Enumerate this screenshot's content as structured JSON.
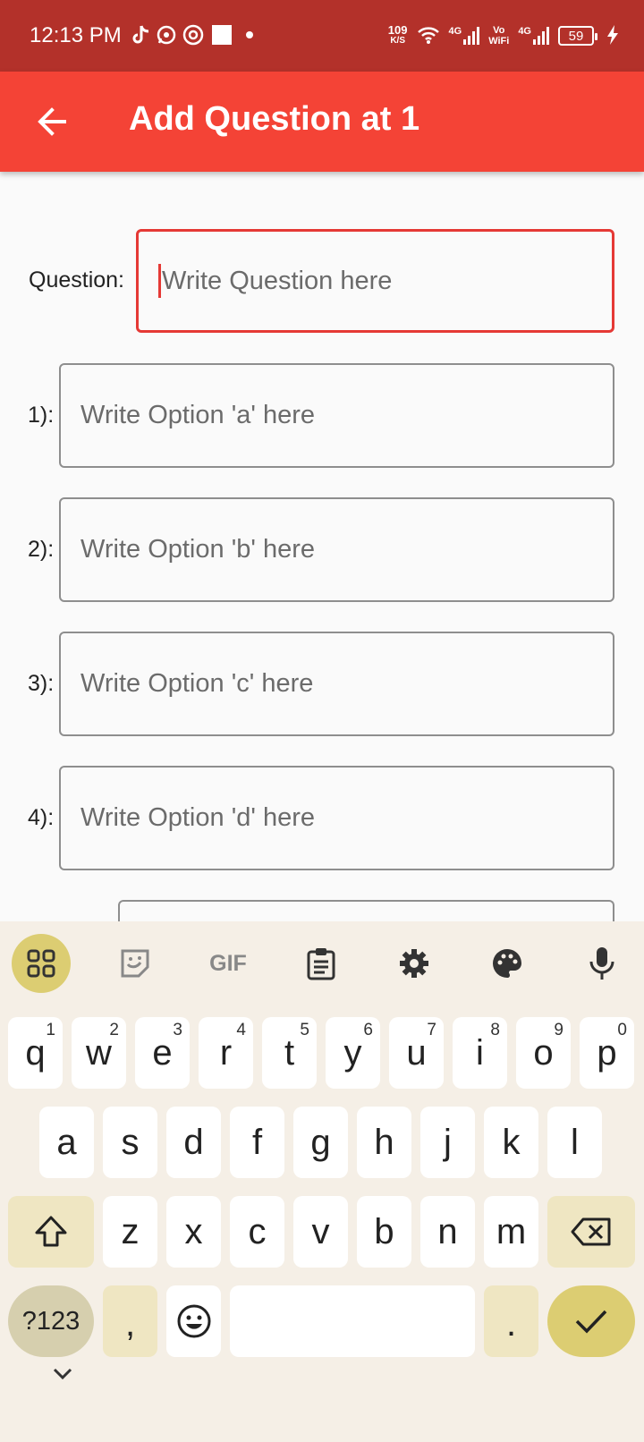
{
  "status_bar": {
    "time": "12:13 PM",
    "speed_value": "109",
    "speed_unit": "K/S",
    "net1": "4G",
    "vo": "Vo",
    "wifi": "WiFi",
    "net2": "4G",
    "battery": "59",
    "icons": [
      "tiktok-icon",
      "whatsapp-icon",
      "target-icon",
      "square-icon",
      "dot-icon",
      "wifi-icon",
      "signal-icon",
      "charging-icon"
    ]
  },
  "appbar": {
    "title": "Add Question at 1",
    "back_icon": "arrow-left-icon"
  },
  "form": {
    "question_label": "Question:",
    "question_placeholder": "Write Question here",
    "options": [
      {
        "label": "1):",
        "placeholder": "Write Option 'a' here"
      },
      {
        "label": "2):",
        "placeholder": "Write Option 'b' here"
      },
      {
        "label": "3):",
        "placeholder": "Write Option 'c' here"
      },
      {
        "label": "4):",
        "placeholder": "Write Option 'd' here"
      }
    ]
  },
  "keyboard": {
    "toolbar": [
      "apps-grid-icon",
      "sticker-icon",
      "gif-icon",
      "clipboard-icon",
      "settings-icon",
      "palette-icon",
      "microphone-icon"
    ],
    "gif_label": "GIF",
    "row1": [
      {
        "key": "q",
        "hint": "1"
      },
      {
        "key": "w",
        "hint": "2"
      },
      {
        "key": "e",
        "hint": "3"
      },
      {
        "key": "r",
        "hint": "4"
      },
      {
        "key": "t",
        "hint": "5"
      },
      {
        "key": "y",
        "hint": "6"
      },
      {
        "key": "u",
        "hint": "7"
      },
      {
        "key": "i",
        "hint": "8"
      },
      {
        "key": "o",
        "hint": "9"
      },
      {
        "key": "p",
        "hint": "0"
      }
    ],
    "row2": [
      "a",
      "s",
      "d",
      "f",
      "g",
      "h",
      "j",
      "k",
      "l"
    ],
    "row3": [
      "z",
      "x",
      "c",
      "v",
      "b",
      "n",
      "m"
    ],
    "symbols_label": "?123",
    "comma": ",",
    "period": ".",
    "accent_color": "#dccd72"
  },
  "colors": {
    "status_bar": "#b3312a",
    "appbar": "#f44336",
    "focus": "#e53935"
  }
}
